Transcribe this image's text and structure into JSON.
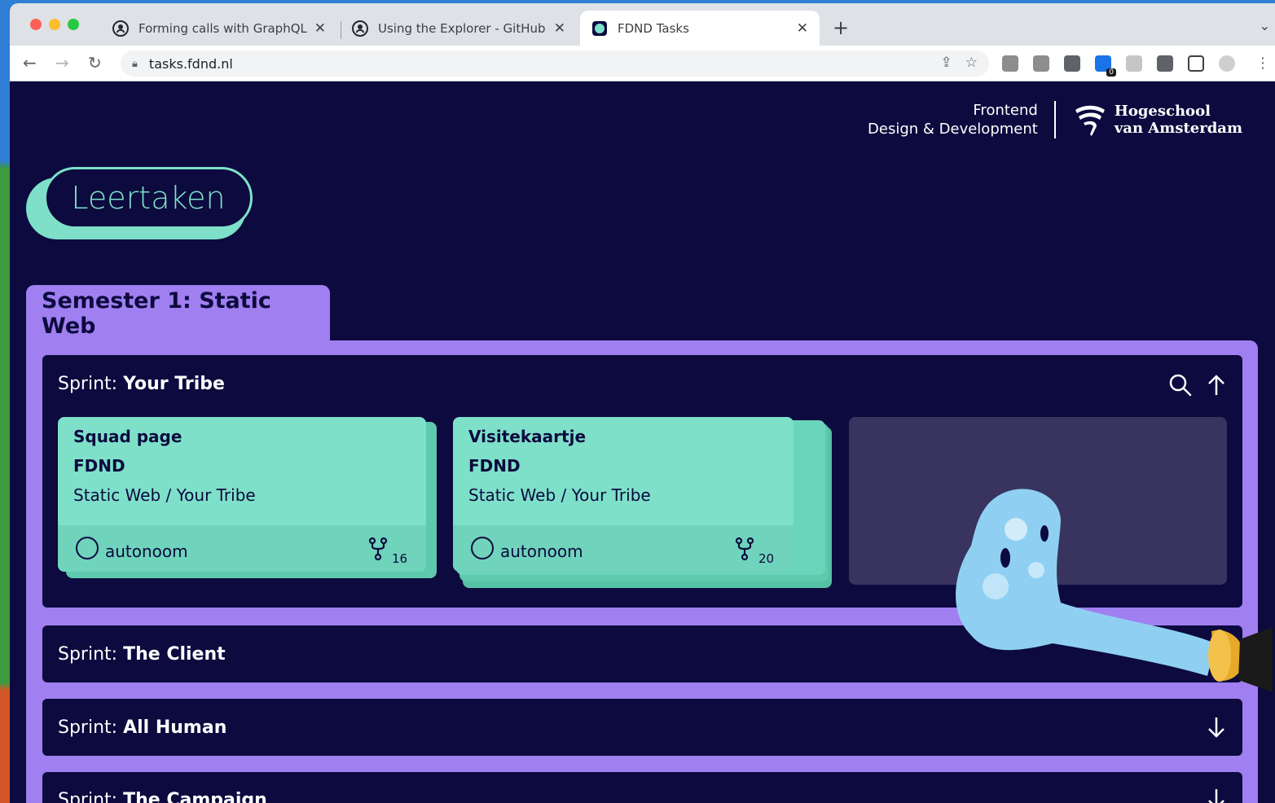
{
  "browser": {
    "tabs": [
      {
        "title": "Forming calls with GraphQL - G",
        "icon": "github-icon"
      },
      {
        "title": "Using the Explorer - GitHub Do",
        "icon": "github-icon"
      },
      {
        "title": "FDND Tasks",
        "icon": "fdnd-favicon"
      }
    ],
    "url": "tasks.fdnd.nl"
  },
  "header": {
    "brand_line1": "Frontend",
    "brand_line2": "Design & Development",
    "school_line1": "Hogeschool",
    "school_line2": "van Amsterdam"
  },
  "page_title": "Leertaken",
  "semester": {
    "title": "Semester 1: Static Web",
    "sprint_label": "Sprint:",
    "sprints": [
      {
        "name": "Your Tribe",
        "tasks": [
          {
            "title": "Squad page",
            "org": "FDND",
            "path": "Static Web / Your Tribe",
            "status": "autonoom",
            "forks": "16"
          },
          {
            "title": "Visitekaartje",
            "org": "FDND",
            "path": "Static Web / Your Tribe",
            "status": "autonoom",
            "forks": "20"
          }
        ]
      },
      {
        "name": "The Client"
      },
      {
        "name": "All Human"
      },
      {
        "name": "The Campaign"
      }
    ]
  },
  "colors": {
    "background": "#0c0a3e",
    "accent_mint": "#7ee0c9",
    "accent_purple": "#a07ff0"
  }
}
